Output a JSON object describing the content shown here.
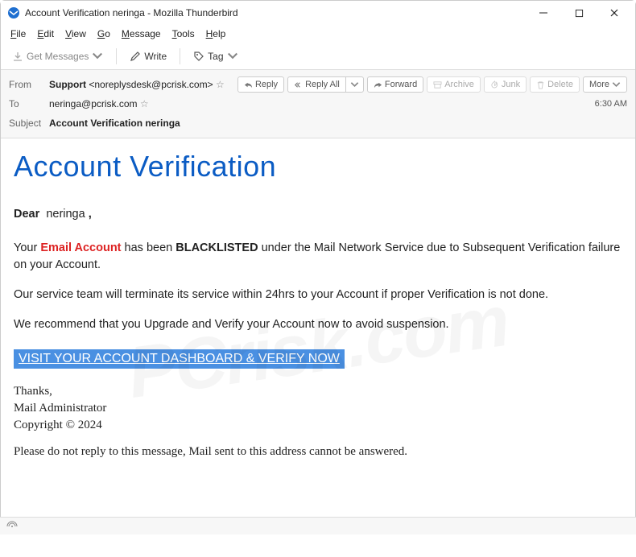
{
  "window": {
    "title": "Account Verification neringa - Mozilla Thunderbird"
  },
  "menubar": {
    "file": "File",
    "edit": "Edit",
    "view": "View",
    "go": "Go",
    "message": "Message",
    "tools": "Tools",
    "help": "Help"
  },
  "toolbar": {
    "getmsg": "Get Messages",
    "write": "Write",
    "tag": "Tag"
  },
  "headers": {
    "from_lbl": "From",
    "from_name": "Support",
    "from_email": "<noreplysdesk@pcrisk.com>",
    "to_lbl": "To",
    "to": "neringa@pcrisk.com",
    "subject_lbl": "Subject",
    "subject": "Account Verification neringa",
    "time": "6:30 AM"
  },
  "actions": {
    "reply": "Reply",
    "replyall": "Reply All",
    "forward": "Forward",
    "archive": "Archive",
    "junk": "Junk",
    "delete": "Delete",
    "more": "More"
  },
  "email": {
    "heading": "Account Verification",
    "dear": "Dear",
    "name": "neringa",
    "p1a": "Your ",
    "p1b": "Email Account",
    "p1c": " has been ",
    "p1d": "BLACKLISTED",
    "p1e": " under the Mail Network Service due to Subsequent Verification failure on your Account.",
    "p2": "Our service team will terminate its service within 24hrs to your Account if proper Verification is not done.",
    "p3": "We recommend that you Upgrade and Verify your Account now to avoid suspension.",
    "cta": "VISIT YOUR ACCOUNT DASHBOARD & VERIFY NOW",
    "thanks": "Thanks,",
    "sig": "Mail Administrator",
    "copy": "Copyright © 2024",
    "noreply": "Please do not reply to this message, Mail sent to this address cannot be answered."
  }
}
